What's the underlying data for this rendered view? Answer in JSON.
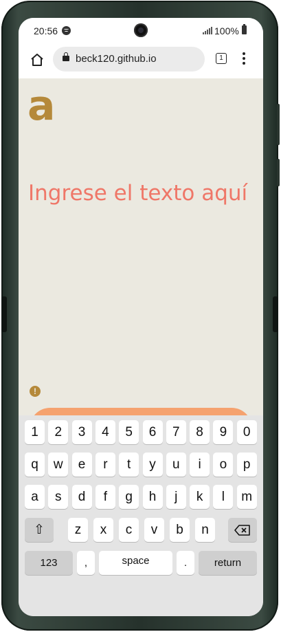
{
  "status_bar": {
    "time": "20:56",
    "battery": "100%"
  },
  "browser": {
    "url": "beck120.github.io",
    "tab_count": "1"
  },
  "page": {
    "logo": "a",
    "input_placeholder": "Ingrese el texto aquí",
    "warning_symbol": "!"
  },
  "colors": {
    "background": "#ebe9e0",
    "accent": "#b5893a",
    "placeholder": "#ef7768",
    "button": "#f5a26f"
  },
  "keyboard": {
    "row_numbers": [
      "1",
      "2",
      "3",
      "4",
      "5",
      "6",
      "7",
      "8",
      "9",
      "0"
    ],
    "row_top": [
      "q",
      "w",
      "e",
      "r",
      "t",
      "y",
      "u",
      "i",
      "o",
      "p"
    ],
    "row_middle": [
      "a",
      "s",
      "d",
      "f",
      "g",
      "h",
      "j",
      "k",
      "l",
      "m"
    ],
    "row_bottom": [
      "z",
      "x",
      "c",
      "v",
      "b",
      "n"
    ],
    "shift_symbol": "⇧",
    "numbers_label": "123",
    "comma_label": ",",
    "space_label": "space",
    "period_label": ".",
    "return_label": "return"
  }
}
